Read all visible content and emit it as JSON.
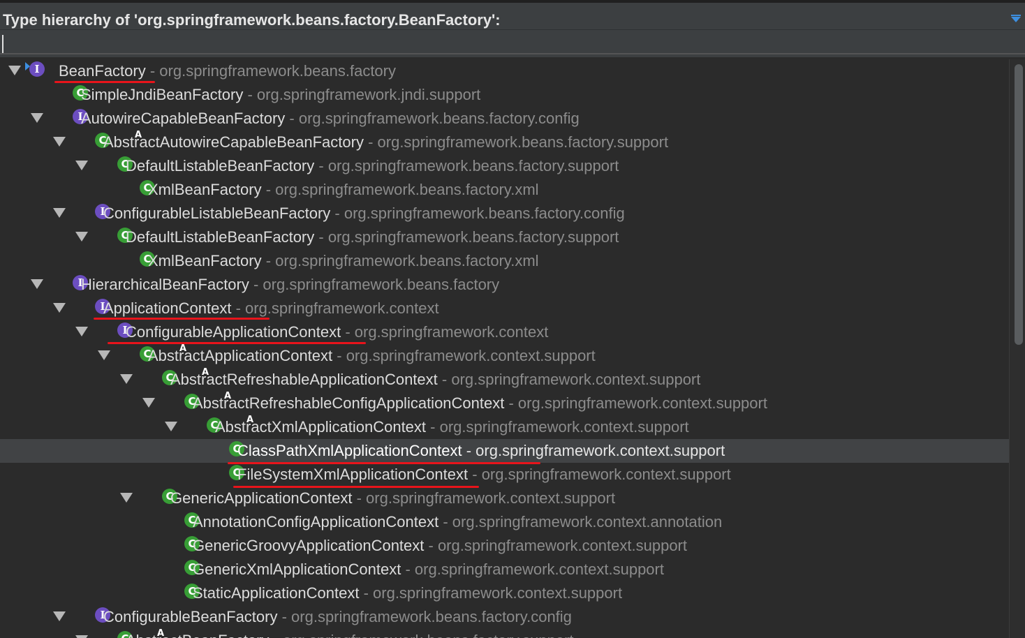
{
  "header": {
    "title": "Type hierarchy of 'org.springframework.beans.factory.BeanFactory':",
    "search_value": ""
  },
  "colors": {
    "class_badge": "#389e36",
    "interface_badge": "#6c4ec0",
    "annotation_underline": "#e8141b",
    "package_text": "#8c8c8c",
    "selected_row": "#414345"
  },
  "tree": [
    {
      "name": "BeanFactory",
      "pkg": " - org.springframework.beans.factory",
      "kind": "interface",
      "depth": 0,
      "expanded": true,
      "implements_marker": true,
      "underlined": true
    },
    {
      "name": "SimpleJndiBeanFactory",
      "pkg": " - org.springframework.jndi.support",
      "kind": "class",
      "depth": 1,
      "expanded": false
    },
    {
      "name": "AutowireCapableBeanFactory",
      "pkg": " - org.springframework.beans.factory.config",
      "kind": "interface",
      "depth": 1,
      "expanded": true
    },
    {
      "name": "AbstractAutowireCapableBeanFactory",
      "pkg": " - org.springframework.beans.factory.support",
      "kind": "abstract-class",
      "depth": 2,
      "expanded": true
    },
    {
      "name": "DefaultListableBeanFactory",
      "pkg": " - org.springframework.beans.factory.support",
      "kind": "class",
      "depth": 3,
      "expanded": true
    },
    {
      "name": "XmlBeanFactory",
      "pkg": " - org.springframework.beans.factory.xml",
      "kind": "class",
      "depth": 4,
      "expanded": false
    },
    {
      "name": "ConfigurableListableBeanFactory",
      "pkg": " - org.springframework.beans.factory.config",
      "kind": "interface",
      "depth": 2,
      "expanded": true
    },
    {
      "name": "DefaultListableBeanFactory",
      "pkg": " - org.springframework.beans.factory.support",
      "kind": "class",
      "depth": 3,
      "expanded": true
    },
    {
      "name": "XmlBeanFactory",
      "pkg": " - org.springframework.beans.factory.xml",
      "kind": "class",
      "depth": 4,
      "expanded": false
    },
    {
      "name": "HierarchicalBeanFactory",
      "pkg": " - org.springframework.beans.factory",
      "kind": "interface",
      "depth": 1,
      "expanded": true
    },
    {
      "name": "ApplicationContext",
      "pkg": " - org.springframework.context",
      "kind": "interface",
      "depth": 2,
      "expanded": true,
      "underlined": true
    },
    {
      "name": "ConfigurableApplicationContext",
      "pkg": " - org.springframework.context",
      "kind": "interface",
      "depth": 3,
      "expanded": true,
      "underlined": true
    },
    {
      "name": "AbstractApplicationContext",
      "pkg": " - org.springframework.context.support",
      "kind": "abstract-class",
      "depth": 4,
      "expanded": true
    },
    {
      "name": "AbstractRefreshableApplicationContext",
      "pkg": " - org.springframework.context.support",
      "kind": "abstract-class",
      "depth": 5,
      "expanded": true
    },
    {
      "name": "AbstractRefreshableConfigApplicationContext",
      "pkg": " - org.springframework.context.support",
      "kind": "abstract-class",
      "depth": 6,
      "expanded": true
    },
    {
      "name": "AbstractXmlApplicationContext",
      "pkg": " - org.springframework.context.support",
      "kind": "abstract-class",
      "depth": 7,
      "expanded": true
    },
    {
      "name": "ClassPathXmlApplicationContext",
      "pkg": " - org.springframework.context.support",
      "kind": "class",
      "depth": 8,
      "expanded": false,
      "selected": true,
      "underlined": true
    },
    {
      "name": "FileSystemXmlApplicationContext",
      "pkg": " - org.springframework.context.support",
      "kind": "class",
      "depth": 8,
      "expanded": false,
      "underlined": true
    },
    {
      "name": "GenericApplicationContext",
      "pkg": " - org.springframework.context.support",
      "kind": "class",
      "depth": 5,
      "expanded": true
    },
    {
      "name": "AnnotationConfigApplicationContext",
      "pkg": " - org.springframework.context.annotation",
      "kind": "class",
      "depth": 6,
      "expanded": false
    },
    {
      "name": "GenericGroovyApplicationContext",
      "pkg": " - org.springframework.context.support",
      "kind": "class",
      "depth": 6,
      "expanded": false
    },
    {
      "name": "GenericXmlApplicationContext",
      "pkg": " - org.springframework.context.support",
      "kind": "class",
      "depth": 6,
      "expanded": false
    },
    {
      "name": "StaticApplicationContext",
      "pkg": " - org.springframework.context.support",
      "kind": "class",
      "depth": 6,
      "expanded": false
    },
    {
      "name": "ConfigurableBeanFactory",
      "pkg": " - org.springframework.beans.factory.config",
      "kind": "interface",
      "depth": 2,
      "expanded": true
    },
    {
      "name": "AbstractBeanFactory",
      "pkg": " - org.springframework.beans.factory.support",
      "kind": "abstract-class",
      "depth": 3,
      "expanded": true
    }
  ]
}
